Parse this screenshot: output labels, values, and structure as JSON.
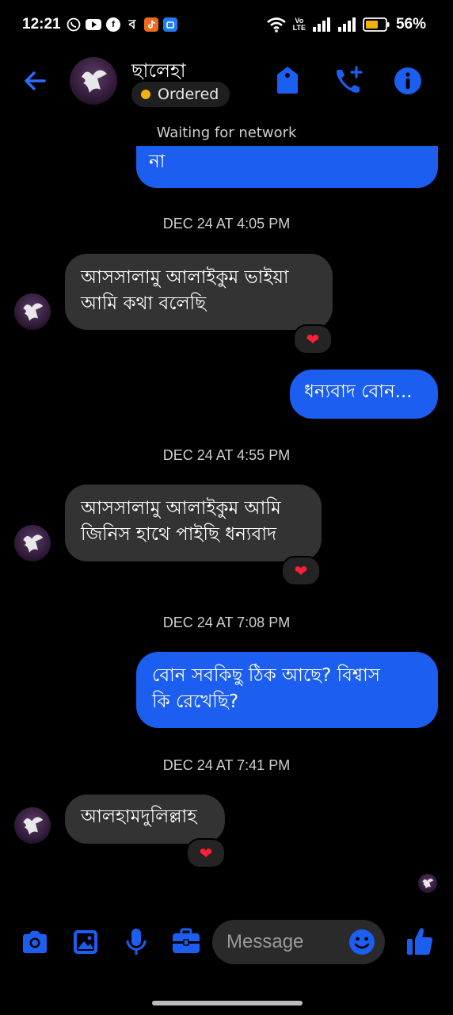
{
  "status_bar": {
    "time": "12:21",
    "volte_top": "Vo",
    "volte_bottom": "LTE",
    "battery": "56%",
    "app_icons": [
      "whatsapp-icon",
      "youtube-icon",
      "facebook-icon",
      "bangla-app-icon",
      "tiktok-icon",
      "bank-app-icon"
    ]
  },
  "header": {
    "contact_name": "ছালেহা",
    "status_label": "Ordered",
    "status_color": "#f0b20f",
    "accent_color": "#1c5ef0"
  },
  "network_note": "Waiting for network",
  "messages": {
    "m0": "না",
    "t1": "DEC 24 AT 4:05 PM",
    "m1_line1": "আসসালামু আলাইকুম  ভাইয়া",
    "m1_line2": "আমি কথা বলেছি",
    "m2": "ধন্যবাদ বোন...",
    "t2": "DEC 24 AT 4:55 PM",
    "m3_line1": "আসসালামু আলাইকুম আমি",
    "m3_line2": "জিনিস হাথে পাইছি  ধন্যবাদ",
    "t3": "DEC 24 AT 7:08 PM",
    "m4_line1": "বোন সবকিছু ঠিক আছে? বিশ্বাস",
    "m4_line2": "কি রেখেছি?",
    "t4": "DEC 24 AT 7:41 PM",
    "m5": "আলহামদুলিল্লাহ",
    "reaction": "❤"
  },
  "composer": {
    "placeholder": "Message"
  }
}
